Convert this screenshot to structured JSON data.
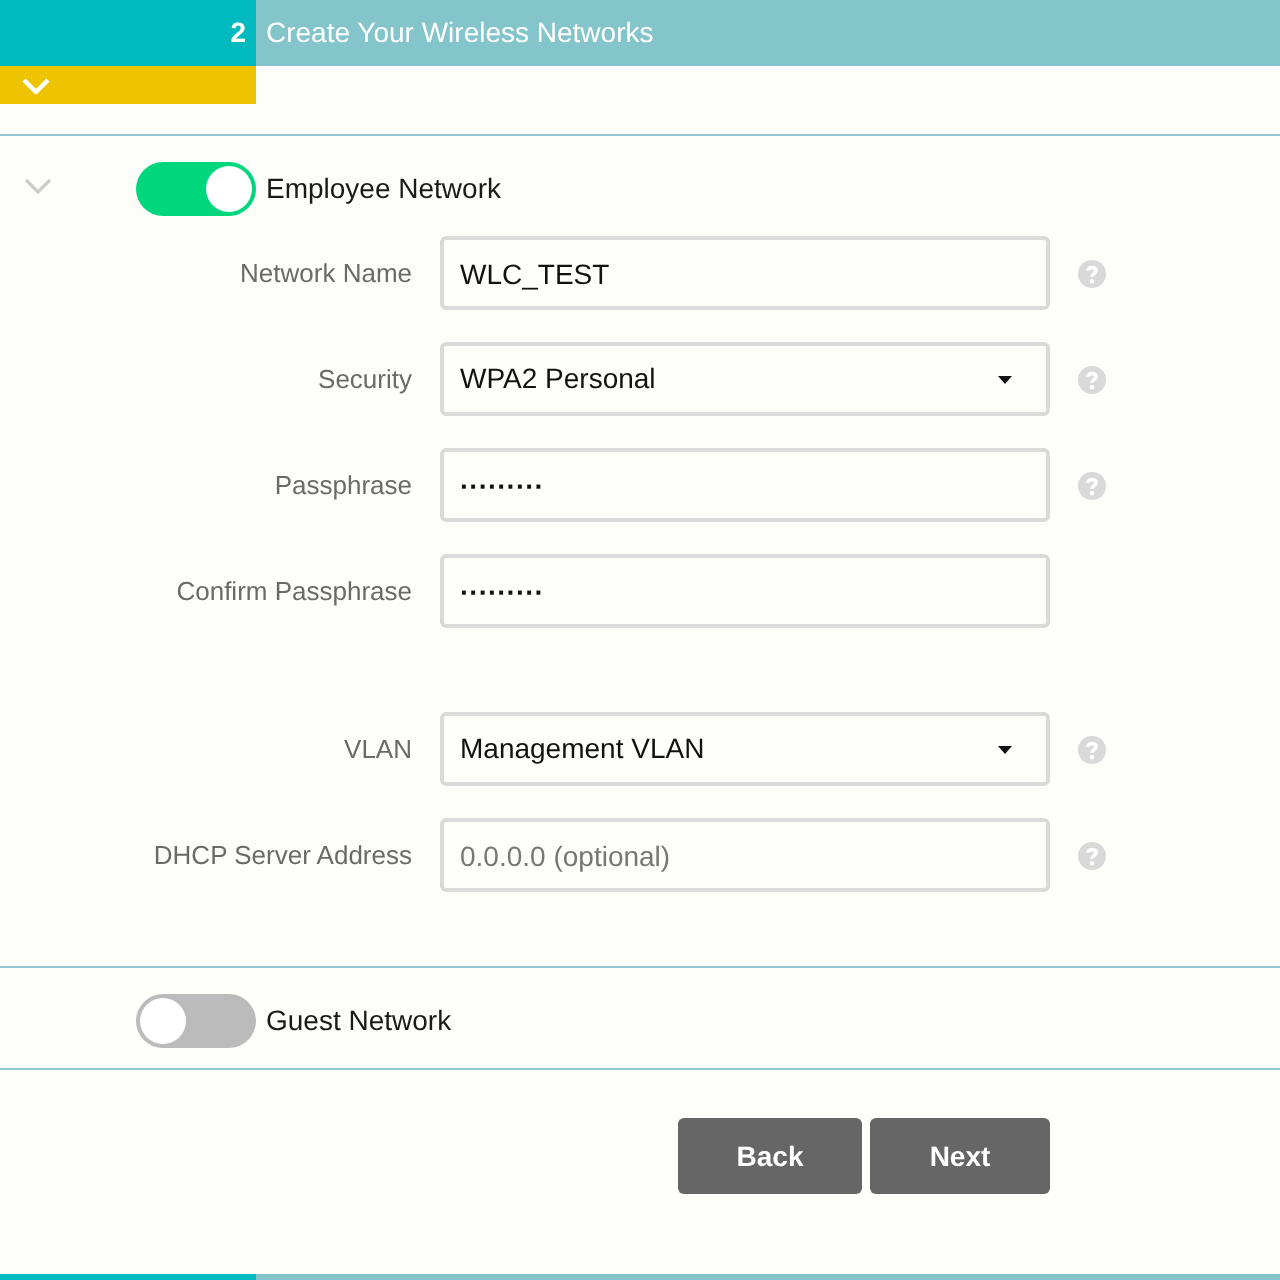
{
  "step": {
    "number": "2",
    "title": "Create Your Wireless Networks"
  },
  "networks": [
    {
      "name": "Employee Network",
      "on": true,
      "expanded": true,
      "field_groups": [
        [
          {
            "kind": "text",
            "label": "Network Name",
            "value": "WLC_TEST",
            "help": true
          },
          {
            "kind": "select",
            "label": "Security",
            "value": "WPA2 Personal",
            "help": true
          },
          {
            "kind": "password",
            "label": "Passphrase",
            "value": "·········",
            "help": true
          },
          {
            "kind": "password",
            "label": "Confirm Passphrase",
            "value": "·········",
            "help": false
          }
        ],
        [
          {
            "kind": "select",
            "label": "VLAN",
            "value": "Management VLAN",
            "help": true
          },
          {
            "kind": "text",
            "label": "DHCP Server Address",
            "placeholder": "0.0.0.0 (optional)",
            "help": true
          }
        ]
      ]
    },
    {
      "name": "Guest Network",
      "on": false,
      "expanded": false
    }
  ],
  "buttons": [
    {
      "label": "Back"
    },
    {
      "label": "Next"
    }
  ]
}
